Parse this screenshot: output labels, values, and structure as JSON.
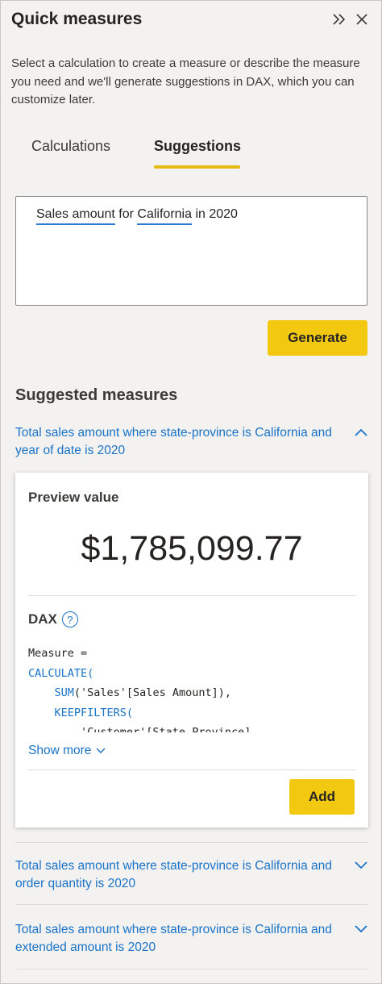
{
  "header": {
    "title": "Quick measures",
    "expand_icon": "double-chevron-right-icon",
    "close_icon": "close-icon"
  },
  "description": "Select a calculation to create a measure or describe the measure you need and we'll generate suggestions in DAX, which you can customize later.",
  "tabs": [
    {
      "label": "Calculations",
      "active": false
    },
    {
      "label": "Suggestions",
      "active": true
    }
  ],
  "query": {
    "words": [
      "Sales amount",
      " for ",
      "California",
      " in 2020"
    ],
    "underlined": [
      true,
      false,
      true,
      false
    ]
  },
  "generate_label": "Generate",
  "suggested_title": "Suggested measures",
  "suggestions": [
    {
      "text": "Total sales amount where state-province is California and year of date is 2020",
      "expanded": true
    },
    {
      "text": "Total sales amount where state-province is California and order quantity is 2020",
      "expanded": false
    },
    {
      "text": "Total sales amount where state-province is California and extended amount is 2020",
      "expanded": false
    }
  ],
  "card": {
    "preview_label": "Preview value",
    "preview_value": "$1,785,099.77",
    "dax_label": "DAX",
    "help_icon": "help-circle-icon",
    "code_lines": [
      "Measure =",
      "CALCULATE(",
      "    SUM('Sales'[Sales Amount]),",
      "    KEEPFILTERS(",
      "        'Customer'[State-Province]"
    ],
    "show_more_label": "Show more",
    "add_label": "Add"
  },
  "colors": {
    "accent_yellow": "#f2c811",
    "link_blue": "#1a73c7",
    "panel_bg": "#f3f2f1"
  }
}
